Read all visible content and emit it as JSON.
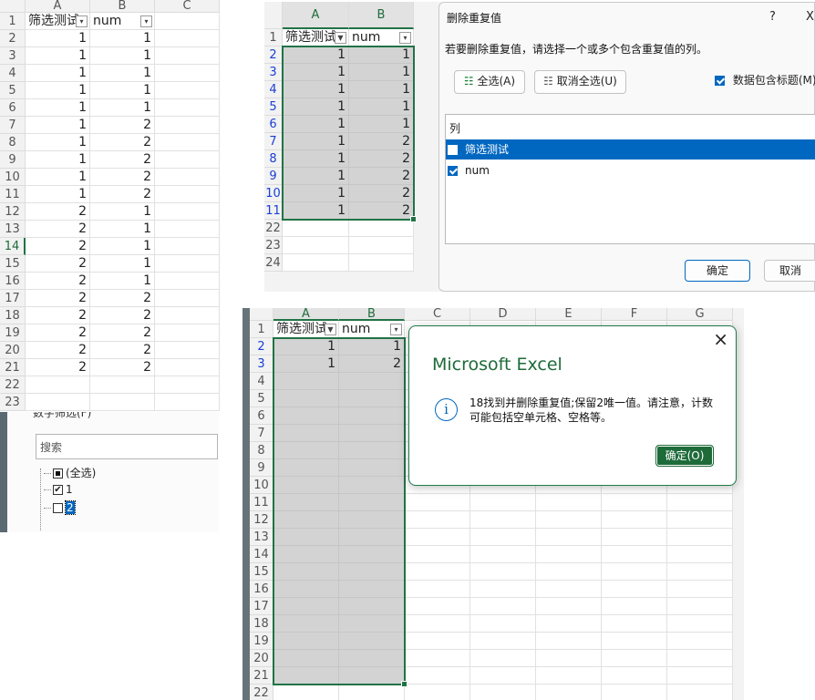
{
  "sheet1": {
    "columns": [
      "A",
      "B",
      "C"
    ],
    "header_a": "筛选测试",
    "header_b": "num",
    "rows": [
      [
        "1",
        "1"
      ],
      [
        "1",
        "1"
      ],
      [
        "1",
        "1"
      ],
      [
        "1",
        "1"
      ],
      [
        "1",
        "1"
      ],
      [
        "1",
        "2"
      ],
      [
        "1",
        "2"
      ],
      [
        "1",
        "2"
      ],
      [
        "1",
        "2"
      ],
      [
        "1",
        "2"
      ],
      [
        "2",
        "1"
      ],
      [
        "2",
        "1"
      ],
      [
        "2",
        "1"
      ],
      [
        "2",
        "1"
      ],
      [
        "2",
        "1"
      ],
      [
        "2",
        "2"
      ],
      [
        "2",
        "2"
      ],
      [
        "2",
        "2"
      ],
      [
        "2",
        "2"
      ],
      [
        "2",
        "2"
      ]
    ],
    "row_numbers": [
      "1",
      "2",
      "3",
      "4",
      "5",
      "6",
      "7",
      "8",
      "9",
      "10",
      "11",
      "12",
      "13",
      "14",
      "15",
      "16",
      "17",
      "18",
      "19",
      "20",
      "21",
      "22",
      "23"
    ],
    "filter_label_partial": "数字筛选(F)",
    "search_placeholder": "搜索",
    "filter_items": [
      {
        "label": "(全选)",
        "state": "partial"
      },
      {
        "label": "1",
        "state": "checked"
      },
      {
        "label": "2",
        "state": "unchecked"
      }
    ]
  },
  "sheet2": {
    "columns": [
      "A",
      "B"
    ],
    "header_a": "筛选测试",
    "header_b": "num",
    "rows": [
      [
        "1",
        "1"
      ],
      [
        "1",
        "1"
      ],
      [
        "1",
        "1"
      ],
      [
        "1",
        "1"
      ],
      [
        "1",
        "1"
      ],
      [
        "1",
        "2"
      ],
      [
        "1",
        "2"
      ],
      [
        "1",
        "2"
      ],
      [
        "1",
        "2"
      ],
      [
        "1",
        "2"
      ]
    ],
    "row_numbers": [
      "1",
      "2",
      "3",
      "4",
      "5",
      "6",
      "7",
      "8",
      "9",
      "10",
      "11",
      "22",
      "23",
      "24"
    ]
  },
  "remove_dup_dialog": {
    "title": "删除重复值",
    "help": "?",
    "close": "X",
    "instruction": "若要删除重复值，请选择一个或多个包含重复值的列。",
    "select_all": "全选(A)",
    "unselect_all": "取消全选(U)",
    "has_headers": "数据包含标题(M)",
    "list_header": "列",
    "columns": [
      {
        "label": "筛选测试",
        "checked": false,
        "selected": true
      },
      {
        "label": "num",
        "checked": true,
        "selected": false
      }
    ],
    "ok": "确定",
    "cancel": "取消"
  },
  "sheet3": {
    "columns": [
      "A",
      "B",
      "C",
      "D",
      "E",
      "F",
      "G"
    ],
    "header_a": "筛选测试",
    "header_b": "num",
    "rows": [
      [
        "1",
        "1"
      ],
      [
        "1",
        "2"
      ]
    ],
    "row_numbers": [
      "1",
      "2",
      "3",
      "4",
      "5",
      "6",
      "7",
      "8",
      "9",
      "10",
      "11",
      "12",
      "13",
      "14",
      "15",
      "16",
      "17",
      "18",
      "19",
      "20",
      "21",
      "22"
    ]
  },
  "msgbox": {
    "title": "Microsoft Excel",
    "close": "×",
    "info_icon": "i",
    "message": "18找到并删除重复值;保留2唯一值。请注意，计数可能包括空单元格、空格等。",
    "ok": "确定(O)"
  },
  "colors": {
    "excel_green": "#217346",
    "accent_blue": "#0067c0",
    "selection_gray": "#d3d3d3"
  }
}
